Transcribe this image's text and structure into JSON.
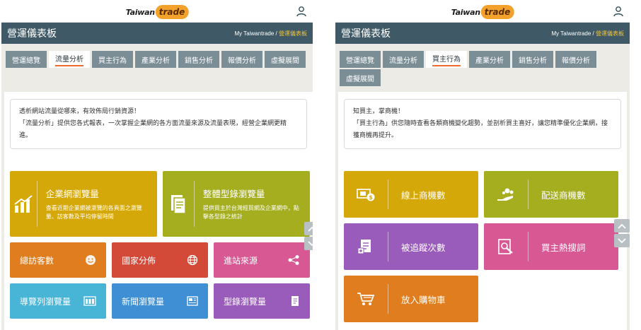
{
  "brand": {
    "logo_taiwan": "Taiwan",
    "logo_trade": "trade"
  },
  "colors": {
    "titlebar": "#3f5a66",
    "tab_inactive": "#7b8d95",
    "mustard": "#d5a80a",
    "olive": "#a4ae1e",
    "orange": "#e07d1f",
    "red": "#d44a39",
    "pink": "#d85894",
    "cyan": "#48b4d6",
    "blue": "#3e8fd3",
    "purple": "#9a5cbb",
    "accent_underline": "#ef6a2f",
    "crumb_current": "#f1c33b"
  },
  "left": {
    "header": {
      "title": "營運儀表板",
      "crumb_root": "My Taiwantrade",
      "crumb_sep": " / ",
      "crumb_current": "營運儀表板",
      "user_icon": "user-icon"
    },
    "tabs": [
      {
        "label": "營運總覽",
        "active": false
      },
      {
        "label": "流量分析",
        "active": true
      },
      {
        "label": "買主行為",
        "active": false
      },
      {
        "label": "產業分析",
        "active": false
      },
      {
        "label": "銷售分析",
        "active": false
      },
      {
        "label": "報價分析",
        "active": false
      },
      {
        "label": "虛擬展間",
        "active": false
      }
    ],
    "intro": {
      "line1": "透析網站流量從哪來，有效佈局行銷資源！",
      "line2": "「流量分析」提供您各式報表，一次掌握企業網的各方面流量來源及流量表現，經營企業網更精進。"
    },
    "big_tiles": [
      {
        "title": "企業網瀏覽量",
        "desc": "查看近期企業網被瀏覽的各頁面之瀏覽量、訪客數及平均停留時間",
        "icon": "bar-chart-icon"
      },
      {
        "title": "整體型錄瀏覽量",
        "desc": "提供買主於台灣經貿網及企業網中，點擊各型錄之統計",
        "icon": "catalog-doc-icon"
      }
    ],
    "small_tiles": [
      {
        "label": "總訪客數",
        "icon": "smiley-icon"
      },
      {
        "label": "國家分佈",
        "icon": "globe-icon"
      },
      {
        "label": "進站來源",
        "icon": "share-nodes-icon"
      },
      {
        "label": "導覽列瀏覽量",
        "icon": "navbar-icon"
      },
      {
        "label": "新聞瀏覽量",
        "icon": "newspaper-icon"
      },
      {
        "label": "型錄瀏覽量",
        "icon": "book-icon"
      }
    ]
  },
  "right": {
    "header": {
      "title": "營運儀表板",
      "crumb_root": "My Taiwantrade",
      "crumb_sep": " / ",
      "crumb_current": "營運儀表板",
      "user_icon": "user-icon"
    },
    "tabs": [
      {
        "label": "營運總覽",
        "active": false
      },
      {
        "label": "流量分析",
        "active": false
      },
      {
        "label": "買主行為",
        "active": true
      },
      {
        "label": "產業分析",
        "active": false
      },
      {
        "label": "銷售分析",
        "active": false
      },
      {
        "label": "報價分析",
        "active": false
      },
      {
        "label": "虛擬展間",
        "active": false
      }
    ],
    "intro": {
      "line1": "知買主，掌商機！",
      "line2": "「買主行為」供您隨時查看各類商機變化趨勢，並剖析買主喜好，讓您精準優化企業網，接獲商機再提升。"
    },
    "tiles": [
      {
        "label": "線上商機數",
        "icon": "money-screen-icon"
      },
      {
        "label": "配送商機數",
        "icon": "hand-coins-icon"
      },
      {
        "label": "被追蹤次數",
        "icon": "tracked-doc-icon"
      },
      {
        "label": "買主熱搜詞",
        "icon": "search-doc-icon"
      },
      {
        "label": "放入購物車",
        "icon": "cart-icon"
      }
    ]
  }
}
